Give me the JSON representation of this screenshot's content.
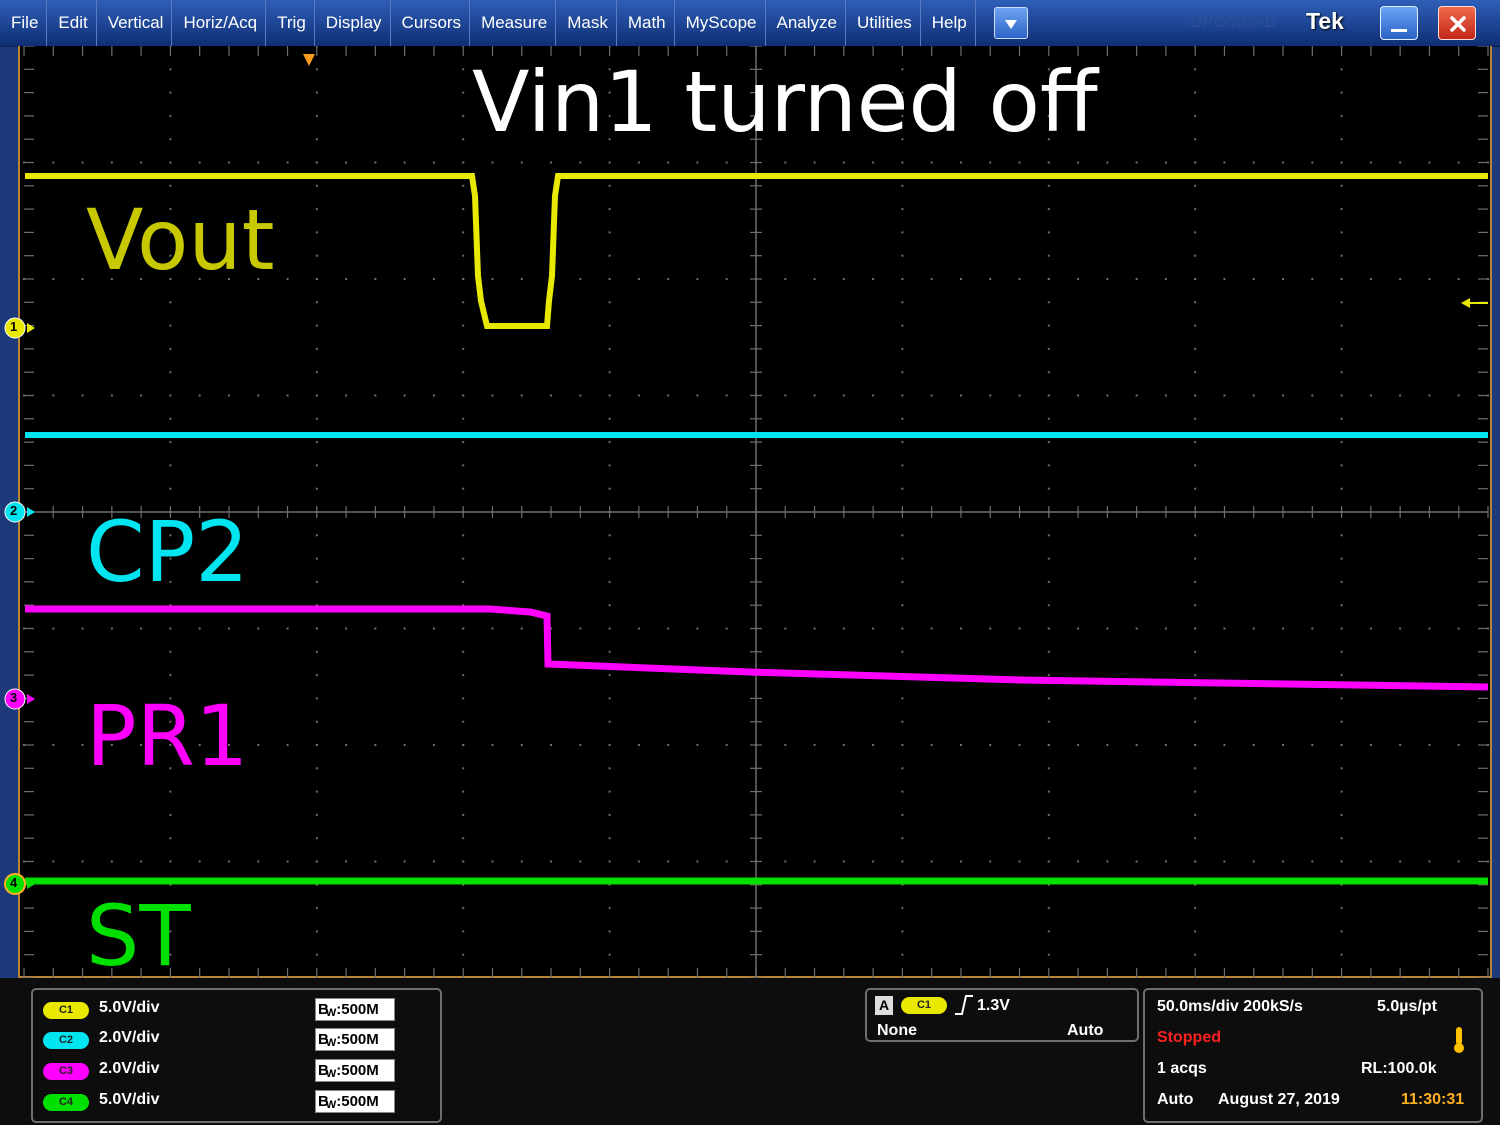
{
  "menu": {
    "items": [
      "File",
      "Edit",
      "Vertical",
      "Horiz/Acq",
      "Trig",
      "Display",
      "Cursors",
      "Measure",
      "Mask",
      "Math",
      "MyScope",
      "Analyze",
      "Utilities",
      "Help"
    ],
    "model": "DPO5054B",
    "brand": "Tek"
  },
  "annotations": {
    "title": "Vin1 turned off",
    "vout": "Vout",
    "cp2": "CP2",
    "pr1": "PR1",
    "st": "ST"
  },
  "channel_markers": [
    "1",
    "2",
    "3",
    "4"
  ],
  "colors": {
    "ch1": "#e8e800",
    "ch2": "#00e5f0",
    "ch3": "#ff00ff",
    "ch4": "#00e000",
    "vout_label": "#c8c800",
    "graticule": "#6e6e6e",
    "stopped": "#ff2020",
    "time": "#ffb020"
  },
  "channels": [
    {
      "badge": "C1",
      "scale": "5.0V/div",
      "bw": "500M",
      "color": "#e8e800"
    },
    {
      "badge": "C2",
      "scale": "2.0V/div",
      "bw": "500M",
      "color": "#00e5f0"
    },
    {
      "badge": "C3",
      "scale": "2.0V/div",
      "bw": "500M",
      "color": "#ff00ff"
    },
    {
      "badge": "C4",
      "scale": "5.0V/div",
      "bw": "500M",
      "color": "#00e000"
    }
  ],
  "trigger": {
    "label": "A",
    "source": "C1",
    "level": "1.3V",
    "coupling": "None",
    "mode": "Auto"
  },
  "acquisition": {
    "timebase": "50.0ms/div 200kS/s",
    "sample_interval": "5.0µs/pt",
    "state": "Stopped",
    "acqs": "1 acqs",
    "record_length": "RL:100.0k",
    "mode": "Auto",
    "date": "August 27, 2019",
    "time": "11:30:31"
  }
}
